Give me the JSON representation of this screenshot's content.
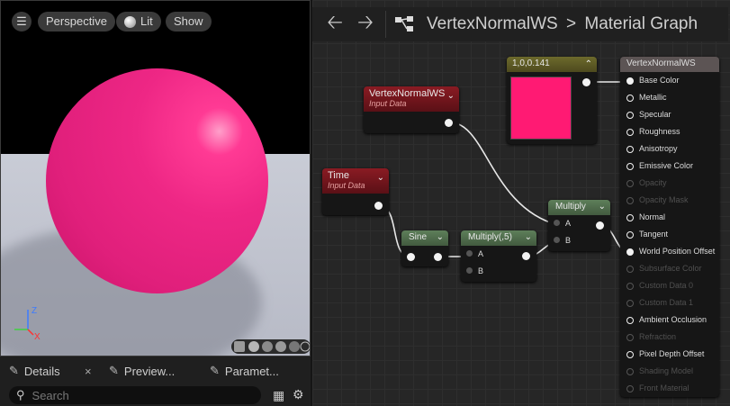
{
  "viewport": {
    "perspective_label": "Perspective",
    "lit_label": "Lit",
    "show_label": "Show",
    "axis_z": "Z",
    "axis_x": "X",
    "sphere_color": "#e8247f"
  },
  "bottom_tabs": [
    {
      "label": "Details",
      "icon": "pencil-icon"
    },
    {
      "label": "Preview...",
      "icon": "pencil-icon"
    },
    {
      "label": "Paramet...",
      "icon": "pencil-icon"
    }
  ],
  "search": {
    "placeholder": "Search"
  },
  "toolbar": {
    "asset_name": "VertexNormalWS",
    "separator": ">",
    "graph_name": "Material Graph"
  },
  "nodes": {
    "constant": {
      "title": "1,0,0.141",
      "color": "#ff1a73"
    },
    "vertex_normal": {
      "title": "VertexNormalWS",
      "subtitle": "Input Data"
    },
    "time": {
      "title": "Time",
      "subtitle": "Input Data"
    },
    "sine": {
      "title": "Sine"
    },
    "multiply5": {
      "title": "Multiply(,5)",
      "pin_a": "A",
      "pin_b": "B"
    },
    "multiply": {
      "title": "Multiply",
      "pin_a": "A",
      "pin_b": "B"
    }
  },
  "output_node": {
    "title": "VertexNormalWS",
    "pins": [
      {
        "label": "Base Color",
        "active": true,
        "connected": true
      },
      {
        "label": "Metallic",
        "active": true,
        "connected": false
      },
      {
        "label": "Specular",
        "active": true,
        "connected": false
      },
      {
        "label": "Roughness",
        "active": true,
        "connected": false
      },
      {
        "label": "Anisotropy",
        "active": true,
        "connected": false
      },
      {
        "label": "Emissive Color",
        "active": true,
        "connected": false
      },
      {
        "label": "Opacity",
        "active": false,
        "connected": false
      },
      {
        "label": "Opacity Mask",
        "active": false,
        "connected": false
      },
      {
        "label": "Normal",
        "active": true,
        "connected": false
      },
      {
        "label": "Tangent",
        "active": true,
        "connected": false
      },
      {
        "label": "World Position Offset",
        "active": true,
        "connected": true
      },
      {
        "label": "Subsurface Color",
        "active": false,
        "connected": false
      },
      {
        "label": "Custom Data 0",
        "active": false,
        "connected": false
      },
      {
        "label": "Custom Data 1",
        "active": false,
        "connected": false
      },
      {
        "label": "Ambient Occlusion",
        "active": true,
        "connected": false
      },
      {
        "label": "Refraction",
        "active": false,
        "connected": false
      },
      {
        "label": "Pixel Depth Offset",
        "active": true,
        "connected": false
      },
      {
        "label": "Shading Model",
        "active": false,
        "connected": false
      },
      {
        "label": "Front Material",
        "active": false,
        "connected": false
      }
    ]
  }
}
